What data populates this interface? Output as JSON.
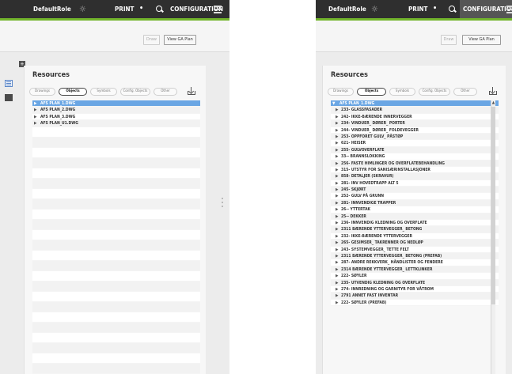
{
  "topbar": {
    "role": "DefaultRole",
    "print": "PRINT",
    "print_dot": "•",
    "configuration": "CONFIGURATION",
    "sun_icon": "☼"
  },
  "toolbar": {
    "draw_label": "Draw",
    "view_ga_plan_label": "View GA Plan"
  },
  "panel": {
    "title": "Resources",
    "tabs": [
      "Drawings",
      "Objects",
      "Symbols",
      "Config. Objects",
      "Other"
    ],
    "active_tab": "Objects"
  },
  "left_list": {
    "rows": [
      "AFS PLAN_1.DWG",
      "AFS PLAN_2.DWG",
      "AFS PLAN_3.DWG",
      "AFS PLAN_U1.DWG"
    ]
  },
  "right_list": {
    "root": "AFS PLAN_1.DWG",
    "rows": [
      "233- GLASSFASADER",
      "242- IKKE-BÆRENDE INNERVEGGER",
      "234- VINDUER_ DØRER_ PORTER",
      "244- VINDUER_ DØRER_ FOLDEVEGGER",
      "253- OPPFORET GULV_ PÅSTØP",
      "621- HEISER",
      "255- GULVOVERFLATE",
      "33-- BRANNSLOKKING",
      "256- FASTE HIMLINGER OG OVERFLATEBEHANDLING",
      "315- UTSTYR FOR SANISÆRINSTALLASJONER",
      "858- DETALJER (SKRAVUR)",
      "281- INV HOVEDTRAPP ALT 5",
      "245- SKJØRT",
      "252- GULV PÅ GRUNN",
      "281- INNVENDIGE TRAPPER",
      "26-- YTTERTAK",
      "25-- DEKKER",
      "236- INNVENDIG KLEDNING OG OVERFLATE",
      "2311 BÆRENDE YTTERVEGGER_ BETONG",
      "232- IKKE-BÆRENDE YTTERVEGGER",
      "265- GESIMSER_ TAKRENNER OG NEDLØP",
      "243- SYSTEMVEGGER_ TETTE FELT",
      "2311 BÆRENDE YTTERVEGGER_ BETONG (PREFAB)",
      "287- ANDRE REKKVERK_ HÅNDLISTER OG FENDERE",
      "2314 BÆRENDE YTTERVEGGER_ LETTKLINKER",
      "222- SØYLER",
      "235- UTVENDIG KLEDNING OG OVERFLATE",
      "274- INNREDNING OG GARNITYR FOR VÅTROM",
      "2791 ANNET FAST INVENTAR",
      "222- SØYLER (PREFAB)"
    ]
  },
  "colors": {
    "topbar_bg": "#2f2f2f",
    "accent_green": "#72b52c",
    "selection_blue": "#6aa6e4"
  }
}
